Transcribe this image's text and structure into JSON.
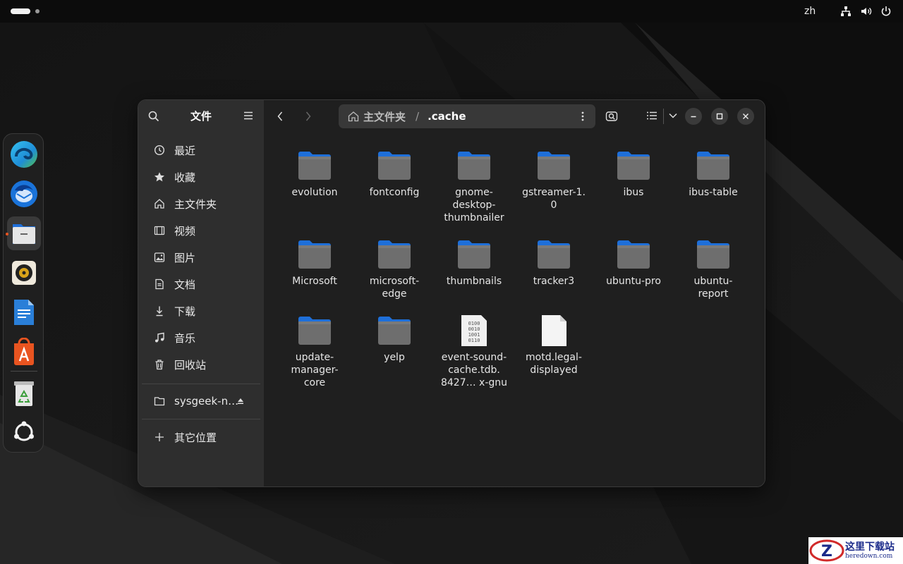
{
  "topbar": {
    "lang": "zh",
    "icons": [
      "network-icon",
      "volume-icon",
      "power-icon"
    ]
  },
  "dock": {
    "apps": [
      {
        "name": "edge-icon"
      },
      {
        "name": "thunderbird-icon"
      },
      {
        "name": "files-icon",
        "active": true
      },
      {
        "name": "rhythmbox-icon"
      },
      {
        "name": "writer-icon"
      },
      {
        "name": "app-center-icon"
      },
      {
        "name": "trash-icon"
      },
      {
        "name": "show-apps-icon"
      }
    ]
  },
  "sidebar": {
    "title": "文件",
    "items": [
      {
        "label": "最近",
        "icon": "recent-icon"
      },
      {
        "label": "收藏",
        "icon": "star-icon"
      },
      {
        "label": "主文件夹",
        "icon": "home-icon"
      },
      {
        "label": "视频",
        "icon": "video-icon"
      },
      {
        "label": "图片",
        "icon": "picture-icon"
      },
      {
        "label": "文档",
        "icon": "document-icon"
      },
      {
        "label": "下载",
        "icon": "download-icon"
      },
      {
        "label": "音乐",
        "icon": "music-icon"
      },
      {
        "label": "回收站",
        "icon": "trash-icon"
      }
    ],
    "drive": {
      "label": "sysgeek-n…",
      "icon": "folder-icon"
    },
    "other": {
      "label": "其它位置",
      "icon": "plus-icon"
    }
  },
  "path": {
    "home": "主文件夹",
    "separator": "/",
    "current": ".cache"
  },
  "files": [
    {
      "name": "evolution",
      "type": "folder"
    },
    {
      "name": "fontconfig",
      "type": "folder"
    },
    {
      "name": "gnome-desktop-thumbnailer",
      "display": "gnome-\ndesktop-\nthumbnailer",
      "type": "folder"
    },
    {
      "name": "gstreamer-1.0",
      "display": "gstreamer-1.\n0",
      "type": "folder"
    },
    {
      "name": "ibus",
      "type": "folder"
    },
    {
      "name": "ibus-table",
      "type": "folder"
    },
    {
      "name": "Microsoft",
      "type": "folder"
    },
    {
      "name": "microsoft-edge",
      "display": "microsoft-\nedge",
      "type": "folder"
    },
    {
      "name": "thumbnails",
      "type": "folder"
    },
    {
      "name": "tracker3",
      "type": "folder"
    },
    {
      "name": "ubuntu-pro",
      "type": "folder"
    },
    {
      "name": "ubuntu-report",
      "display": "ubuntu-\nreport",
      "type": "folder"
    },
    {
      "name": "update-manager-core",
      "display": "update-\nmanager-\ncore",
      "type": "folder"
    },
    {
      "name": "yelp",
      "type": "folder"
    },
    {
      "name": "event-sound-cache.tdb.8427…x-gnu",
      "display": "event-sound-\ncache.tdb.\n8427… x-gnu",
      "type": "binary"
    },
    {
      "name": "motd.legal-displayed",
      "display": "motd.legal-\ndisplayed",
      "type": "text"
    }
  ],
  "watermark": {
    "title": "这里下载站",
    "sub": "heredown.com"
  },
  "colors": {
    "accent": "#e95420",
    "folder": "#1e6fd9"
  }
}
